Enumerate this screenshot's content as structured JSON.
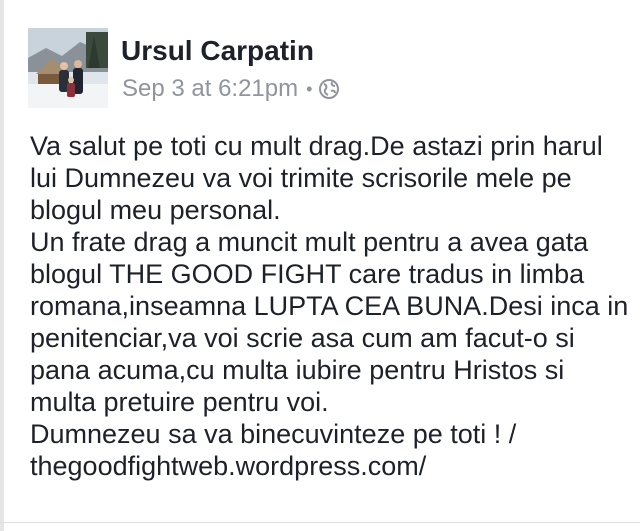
{
  "post": {
    "author": "Ursul Carpatin",
    "timestamp": "Sep 3 at 6:21pm",
    "separator": "•",
    "privacy_icon": "globe-icon",
    "lines": [
      "Va salut pe toti cu mult drag.De astazi prin harul",
      "lui Dumnezeu va voi trimite scrisorile mele pe",
      "blogul meu personal.",
      "Un frate drag a muncit mult pentru a avea gata",
      "blogul THE GOOD FIGHT care tradus in limba",
      "romana,inseamna LUPTA CEA BUNA.Desi inca in",
      "penitenciar,va voi scrie asa cum am facut-o si",
      "pana acuma,cu multa iubire pentru Hristos si",
      "multa pretuire pentru voi.",
      "Dumnezeu sa va binecuvinteze pe toti ! /",
      "thegoodfightweb.wordpress.com/"
    ]
  },
  "colors": {
    "text": "#1d2129",
    "meta": "#90949c",
    "background": "#ffffff"
  }
}
